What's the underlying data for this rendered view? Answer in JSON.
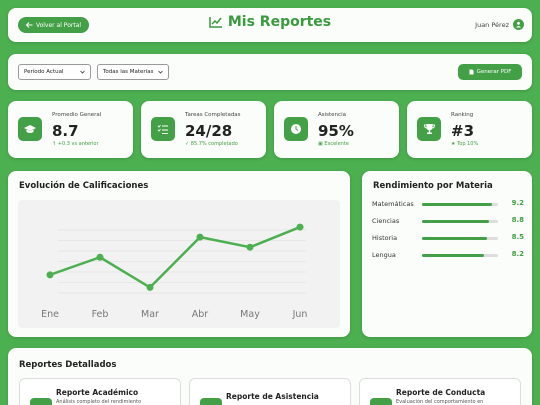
{
  "header": {
    "back_label": "Volver al Portal",
    "title": "Mis Reportes",
    "user_name": "Juan Pérez"
  },
  "filters": {
    "period": "Período Actual",
    "subject": "Todas las Materias",
    "pdf_label": "Generar PDF"
  },
  "stats": [
    {
      "label": "Promedio General",
      "value": "8.7",
      "sub": "+0.3 vs anterior",
      "icon": "graduation-cap-icon"
    },
    {
      "label": "Tareas Completadas",
      "value": "24/28",
      "sub": "85.7% completado",
      "icon": "tasks-icon"
    },
    {
      "label": "Asistencia",
      "value": "95%",
      "sub": "Excelente",
      "icon": "clock-icon"
    },
    {
      "label": "Ranking",
      "value": "#3",
      "sub": "Top 10%",
      "icon": "trophy-icon"
    }
  ],
  "chart_section": {
    "title": "Evolución de Calificaciones"
  },
  "chart_data": {
    "type": "line",
    "categories": [
      "Ene",
      "Feb",
      "Mar",
      "Abr",
      "May",
      "Jun"
    ],
    "values": [
      7.5,
      8.2,
      7.0,
      9.0,
      8.6,
      9.4
    ],
    "ylim": [
      6.5,
      10
    ],
    "grid": true,
    "color": "#4caf50"
  },
  "subjects": {
    "title": "Rendimiento por Materia",
    "items": [
      {
        "name": "Matemáticas",
        "value": "9.2",
        "fraction": 0.92
      },
      {
        "name": "Ciencias",
        "value": "8.8",
        "fraction": 0.88
      },
      {
        "name": "Historia",
        "value": "8.5",
        "fraction": 0.85
      },
      {
        "name": "Lengua",
        "value": "8.2",
        "fraction": 0.82
      }
    ]
  },
  "reports": {
    "title": "Reportes Detallados",
    "items": [
      {
        "title": "Reporte Académico",
        "desc": "Análisis completo del rendimiento"
      },
      {
        "title": "Reporte de Asistencia",
        "desc": ""
      },
      {
        "title": "Reporte de Conducta",
        "desc": "Evaluación del comportamiento en"
      }
    ]
  }
}
